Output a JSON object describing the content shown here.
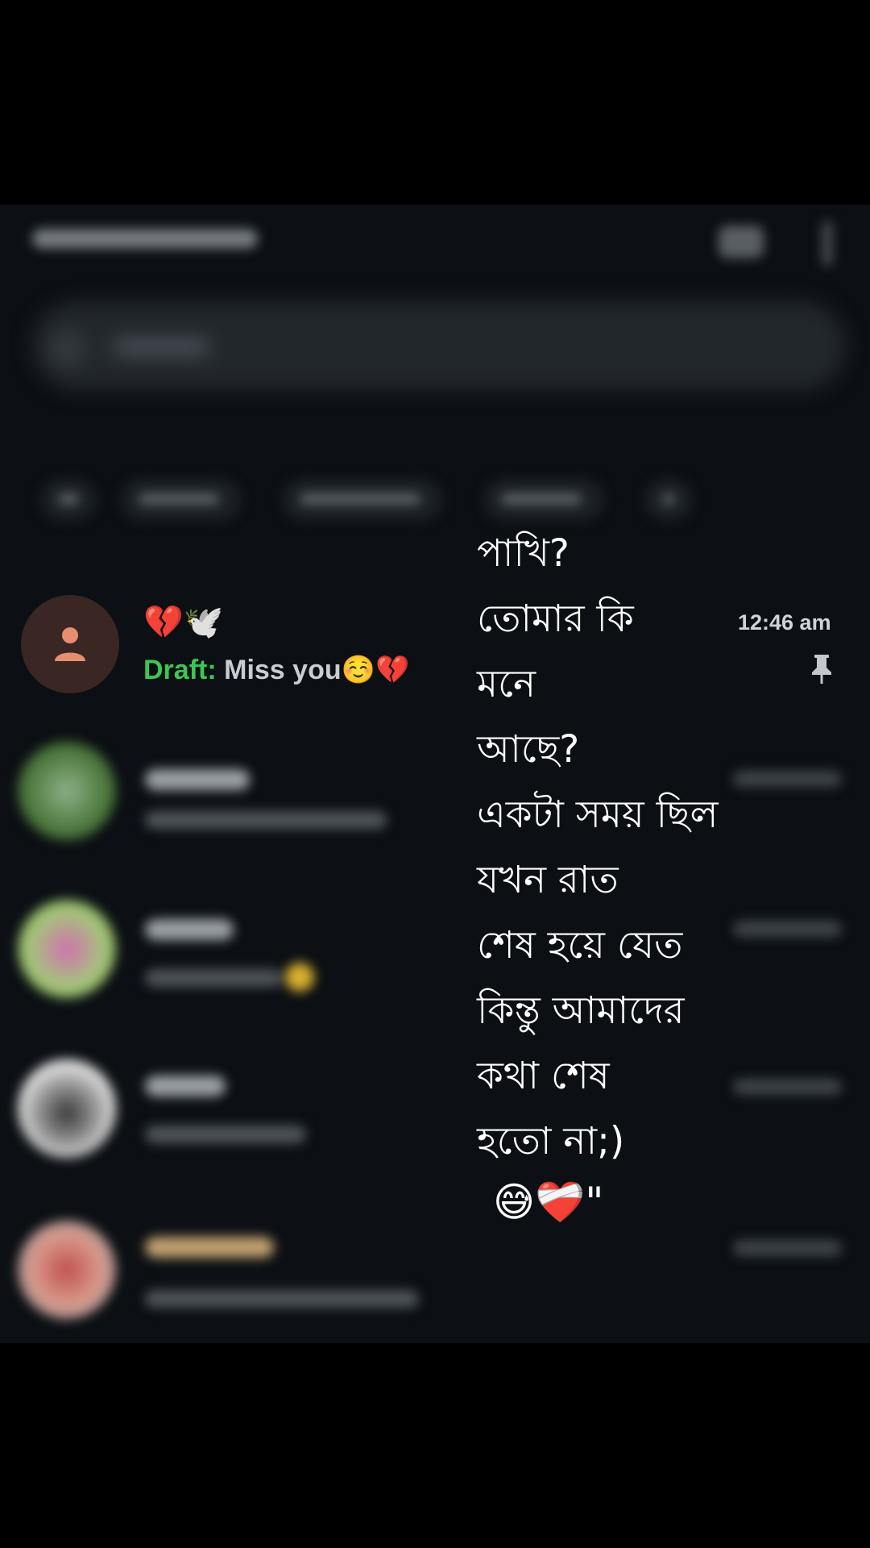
{
  "chat_list": {
    "pinned_chat": {
      "name_emojis": "💔🕊️",
      "draft_label": "Draft:",
      "draft_text": "Miss you",
      "draft_emojis": "☺️💔",
      "time": "12:46 am",
      "pin_icon": "pin-icon",
      "avatar_icon": "person-icon"
    }
  },
  "overlay": {
    "poem_lines": [
      "পাখি?",
      "তোমার কি",
      "মনে",
      "আছে?",
      "একটা সময় ছিল",
      "যখন রাত",
      "শেষ হয়ে যেত",
      "কিন্তু আমাদের",
      "কথা শেষ",
      "হতো না;)"
    ],
    "closing": "😅❤️‍🩹\""
  },
  "colors": {
    "background": "#0c1014",
    "draft_green": "#3ec653",
    "avatar_bg": "#3a2622",
    "avatar_icon": "#e58f70"
  }
}
